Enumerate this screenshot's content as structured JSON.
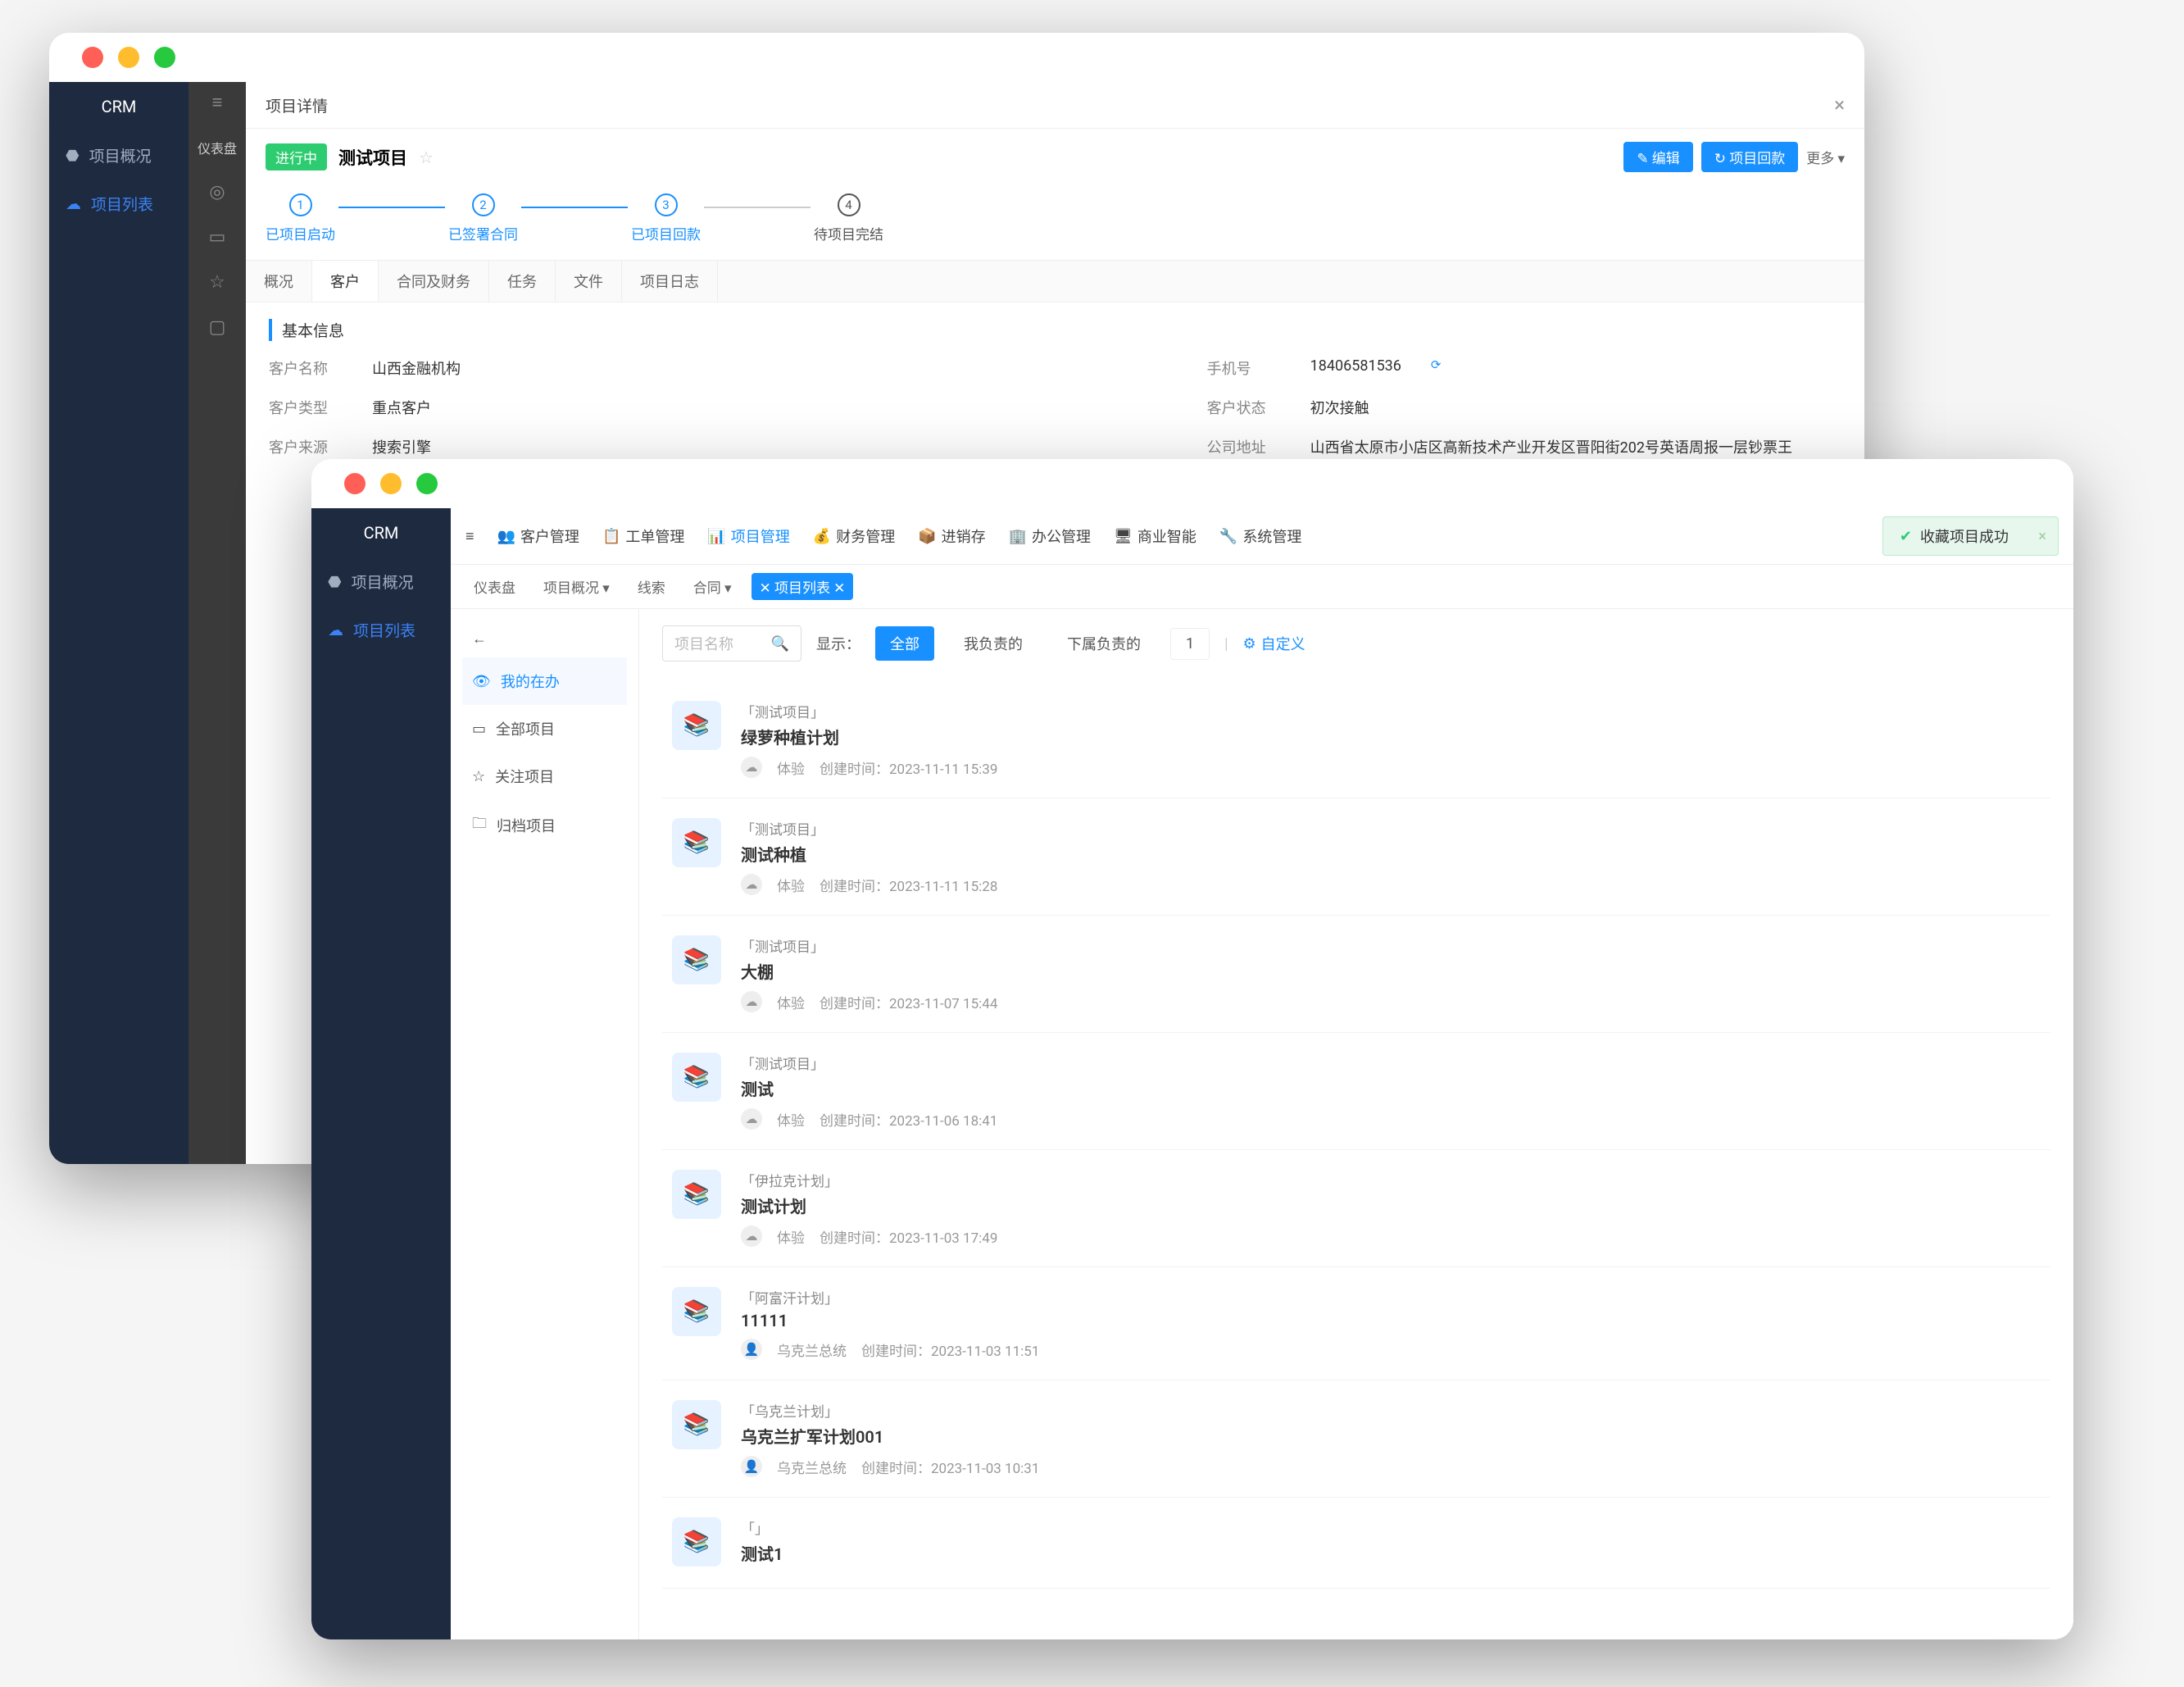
{
  "w1": {
    "crm": "CRM",
    "side": [
      "项目概况",
      "项目列表"
    ],
    "header": "项目详情",
    "status": "进行中",
    "title": "测试项目",
    "steps": [
      "已项目启动",
      "已签署合同",
      "已项目回款",
      "待项目完结"
    ],
    "btns": {
      "edit": "✎ 编辑",
      "back": "↻ 项目回款",
      "more": "更多 ▾"
    },
    "tabs": [
      "概况",
      "客户",
      "合同及财务",
      "任务",
      "文件",
      "项目日志"
    ],
    "section": "基本信息",
    "fields": {
      "name_l": "客户名称",
      "name_v": "山西金融机构",
      "type_l": "客户类型",
      "type_v": "重点客户",
      "src_l": "客户来源",
      "src_v": "搜索引擎",
      "phone_l": "手机号",
      "phone_v": "18406581536",
      "stat_l": "客户状态",
      "stat_v": "初次接触",
      "addr_l": "公司地址",
      "addr_v": "山西省太原市小店区高新技术产业开发区晋阳街202号英语周报一层钞票王"
    }
  },
  "w2": {
    "crm": "CRM",
    "side": [
      "项目概况",
      "项目列表"
    ],
    "nav": [
      "客户管理",
      "工单管理",
      "项目管理",
      "财务管理",
      "进销存",
      "办公管理",
      "商业智能",
      "系统管理"
    ],
    "toast": "收藏项目成功",
    "crumbs": [
      "仪表盘",
      "项目概况 ▾",
      "线索",
      "合同 ▾"
    ],
    "chip": "✕ 项目列表 ✕",
    "panel_h": "←",
    "panel": [
      "我的在办",
      "全部项目",
      "关注项目",
      "归档项目"
    ],
    "search_ph": "项目名称",
    "show": "显示：",
    "filters": [
      "全部",
      "我负责的",
      "下属负责的",
      "1"
    ],
    "custom": "自定义",
    "items": [
      {
        "tag": "「测试项目」",
        "title": "绿萝种植计划",
        "owner": "体验",
        "time_l": "创建时间：",
        "time": "2023-11-11 15:39",
        "ava": "cloud"
      },
      {
        "tag": "「测试项目」",
        "title": "测试种植",
        "owner": "体验",
        "time_l": "创建时间：",
        "time": "2023-11-11 15:28",
        "ava": "cloud"
      },
      {
        "tag": "「测试项目」",
        "title": "大棚",
        "owner": "体验",
        "time_l": "创建时间：",
        "time": "2023-11-07 15:44",
        "ava": "cloud"
      },
      {
        "tag": "「测试项目」",
        "title": "测试",
        "owner": "体验",
        "time_l": "创建时间：",
        "time": "2023-11-06 18:41",
        "ava": "cloud"
      },
      {
        "tag": "「伊拉克计划」",
        "title": "测试计划",
        "owner": "体验",
        "time_l": "创建时间：",
        "time": "2023-11-03 17:49",
        "ava": "cloud"
      },
      {
        "tag": "「阿富汗计划」",
        "title": "11111",
        "owner": "乌克兰总统",
        "time_l": "创建时间：",
        "time": "2023-11-03 11:51",
        "ava": "user"
      },
      {
        "tag": "「乌克兰计划」",
        "title": "乌克兰扩军计划001",
        "owner": "乌克兰总统",
        "time_l": "创建时间：",
        "time": "2023-11-03 10:31",
        "ava": "user"
      },
      {
        "tag": "「」",
        "title": "测试1",
        "owner": "",
        "time_l": "",
        "time": "",
        "ava": ""
      }
    ]
  }
}
